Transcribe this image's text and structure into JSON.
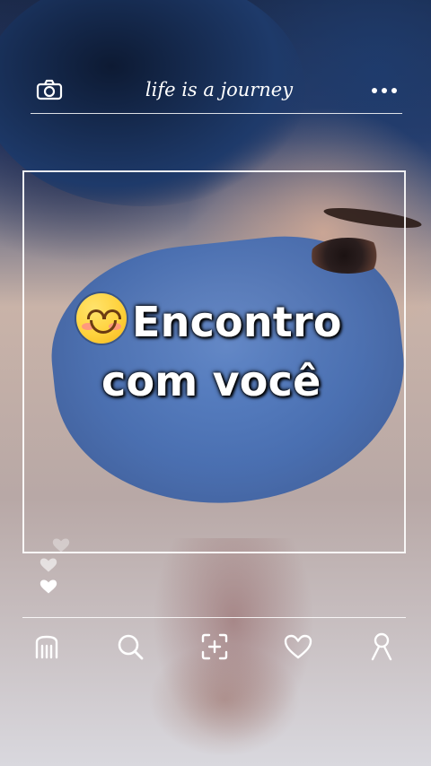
{
  "header": {
    "title": "life is a journey",
    "camera_icon": "camera-icon",
    "more_icon": "more-icon"
  },
  "post": {
    "headline_line1": "Encontro",
    "headline_line2": "com você",
    "emoji": "smiling-face-emoji"
  },
  "likes": {
    "icons": [
      "heart-icon",
      "heart-icon",
      "heart-icon"
    ]
  },
  "bottom_nav": {
    "items": [
      {
        "name": "home",
        "icon": "home-icon"
      },
      {
        "name": "search",
        "icon": "search-icon"
      },
      {
        "name": "add",
        "icon": "add-photo-icon"
      },
      {
        "name": "favorites",
        "icon": "heart-outline-icon"
      },
      {
        "name": "profile",
        "icon": "profile-icon"
      }
    ]
  },
  "colors": {
    "overlay_line": "#ffffff",
    "headline_text": "#ffffff",
    "text_shadow": "#000000"
  }
}
